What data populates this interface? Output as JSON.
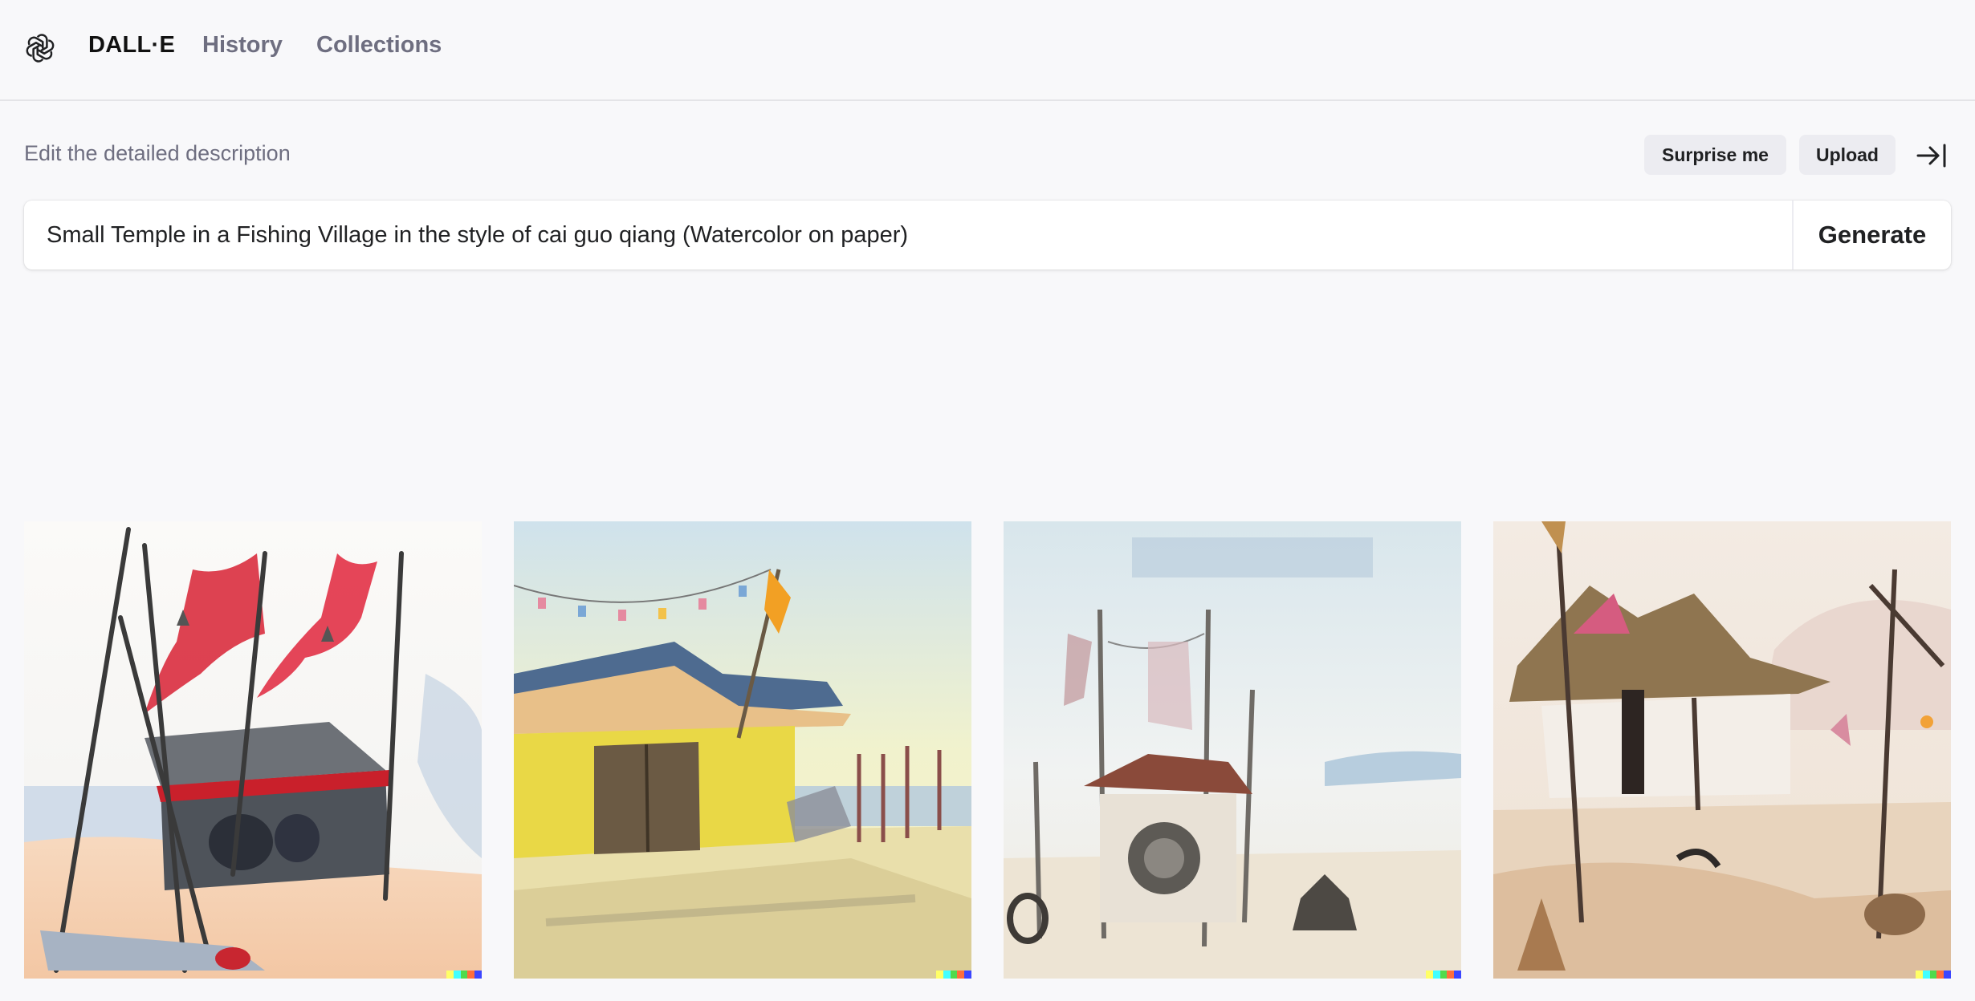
{
  "nav": {
    "brand": "DALL·E",
    "history": "History",
    "collections": "Collections"
  },
  "prompt": {
    "caption": "Edit the detailed description",
    "value": "Small Temple in a Fishing Village in the style of cai guo qiang (Watercolor on paper)",
    "surprise_label": "Surprise me",
    "upload_label": "Upload",
    "generate_label": "Generate"
  },
  "signature_colors": [
    "#ffff66",
    "#42ffff",
    "#51da4c",
    "#ff6e3c",
    "#3c46ff"
  ],
  "icons": {
    "logo": "openai-logo-icon",
    "collapse": "arrow-to-right-icon"
  }
}
